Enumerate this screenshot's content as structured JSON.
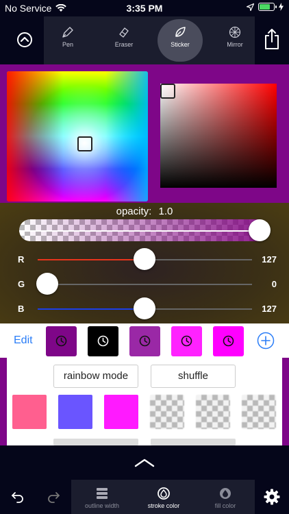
{
  "status": {
    "carrier": "No Service",
    "time": "3:35 PM",
    "battery_level": 0.8
  },
  "toolbar": {
    "tools": [
      {
        "label": "Pen",
        "icon": "pen-icon"
      },
      {
        "label": "Eraser",
        "icon": "eraser-icon"
      },
      {
        "label": "Sticker",
        "icon": "leaf-icon",
        "active": true
      },
      {
        "label": "Mirror",
        "icon": "mirror-icon"
      }
    ]
  },
  "picker": {
    "panel_color": "#7e0688"
  },
  "sliders": {
    "opacity_label": "opacity:",
    "opacity_value": "1.0",
    "r_label": "R",
    "g_label": "G",
    "b_label": "B",
    "r_value": "127",
    "g_value": "0",
    "b_value": "127",
    "r_fraction": 0.498,
    "g_fraction": 0.0,
    "b_fraction": 0.498
  },
  "swatches": {
    "edit_label": "Edit",
    "colors": [
      "#7e0688",
      "#000000",
      "#9a28a6",
      "#ff22ff",
      "#ff00ff"
    ]
  },
  "suggestions": {
    "rainbow_label": "rainbow mode",
    "shuffle_label": "shuffle",
    "colors": [
      "#ff5f8f",
      "#6a55ff",
      "#ff1aff"
    ]
  },
  "bottom": {
    "tabs": [
      {
        "label": "outline width",
        "icon": "outline-width-icon"
      },
      {
        "label": "stroke color",
        "icon": "stroke-color-icon",
        "active": true
      },
      {
        "label": "fill color",
        "icon": "fill-color-icon"
      }
    ]
  }
}
